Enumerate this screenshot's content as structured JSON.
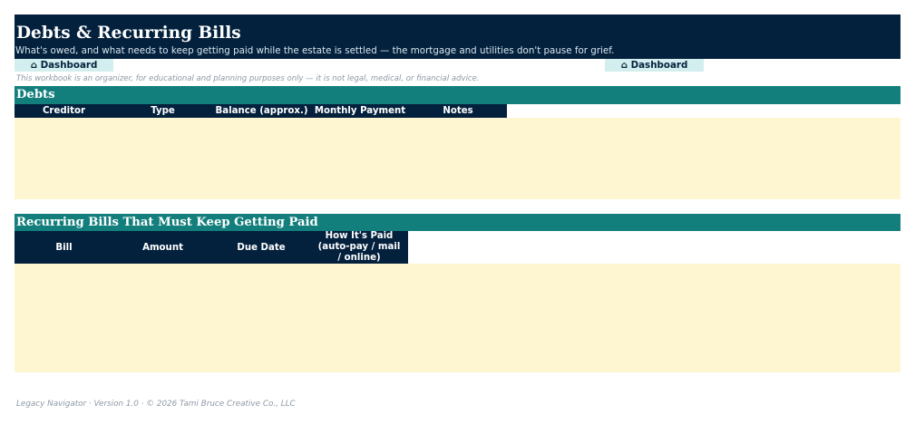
{
  "page": {
    "title": "Debts & Recurring Bills",
    "subtitle": "What's owed, and what needs to keep getting paid while the estate is settled — the mortgage and utilities don't pause for grief.",
    "nav_left_label": "⌂ Dashboard",
    "nav_right_label": "⌂ Dashboard",
    "disclaimer": "This workbook is an organizer, for educational and planning purposes only — it is not legal, medical, or financial advice."
  },
  "debts": {
    "title": "Debts",
    "columns": [
      "Creditor",
      "Type",
      "Balance (approx.)",
      "Monthly Payment",
      "Notes"
    ],
    "rows": []
  },
  "bills": {
    "title": "Recurring Bills That Must Keep Getting Paid",
    "columns": [
      "Bill",
      "Amount",
      "Due Date",
      "How It's Paid (auto-pay / mail / online)"
    ],
    "rows": []
  },
  "footer": {
    "text": "Legacy Navigator · Version 1.0 · © 2026 Tami Bruce Creative Co., LLC"
  },
  "colors": {
    "navy": "#03213d",
    "teal": "#137f7c",
    "entry_fill": "#fdf6d0",
    "nav_button": "#d3eeee"
  }
}
